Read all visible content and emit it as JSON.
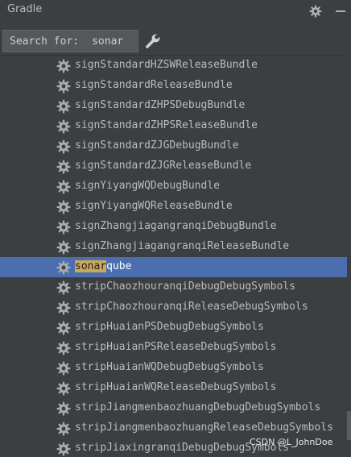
{
  "panel": {
    "title": "Gradle"
  },
  "header_icons": {
    "settings": "gear-icon",
    "minimize": "minus-icon"
  },
  "search": {
    "label": "Search for:",
    "value": "sonar"
  },
  "toolbar": {
    "wrench": "wrench-icon"
  },
  "tasks": [
    {
      "label": "signStandardHZSWReleaseBundle"
    },
    {
      "label": "signStandardReleaseBundle"
    },
    {
      "label": "signStandardZHPSDebugBundle"
    },
    {
      "label": "signStandardZHPSReleaseBundle"
    },
    {
      "label": "signStandardZJGDebugBundle"
    },
    {
      "label": "signStandardZJGReleaseBundle"
    },
    {
      "label": "signYiyangWQDebugBundle"
    },
    {
      "label": "signYiyangWQReleaseBundle"
    },
    {
      "label": "signZhangjiagangranqiDebugBundle"
    },
    {
      "label": "signZhangjiagangranqiReleaseBundle"
    },
    {
      "label_match": "sonar",
      "label_rest": "qube",
      "selected": true
    },
    {
      "label": "stripChaozhouranqiDebugDebugSymbols"
    },
    {
      "label": "stripChaozhouranqiReleaseDebugSymbols"
    },
    {
      "label": "stripHuaianPSDebugDebugSymbols"
    },
    {
      "label": "stripHuaianPSReleaseDebugSymbols"
    },
    {
      "label": "stripHuaianWQDebugDebugSymbols"
    },
    {
      "label": "stripHuaianWQReleaseDebugSymbols"
    },
    {
      "label": "stripJiangmenbaozhuangDebugDebugSymbols"
    },
    {
      "label": "stripJiangmenbaozhuangReleaseDebugSymbols"
    },
    {
      "label": "stripJiaxingranqiDebugDebugSymbols"
    }
  ],
  "watermark": "CSDN @L_JohnDoe",
  "colors": {
    "selection": "#4b6eaf",
    "highlight": "#c9a95c",
    "background": "#3c3f41"
  }
}
